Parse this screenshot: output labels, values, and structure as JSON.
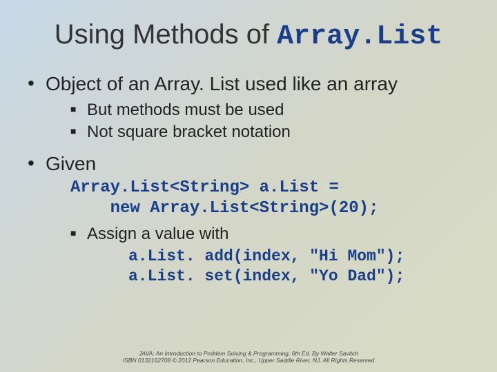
{
  "title": {
    "prefix": "Using Methods of ",
    "code": "Array.List"
  },
  "bullets": [
    {
      "text": "Object of an Array. List used like an array",
      "sub": [
        "But methods must be used",
        "Not square bracket notation"
      ]
    },
    {
      "text": "Given",
      "code": "Array.List<String> a.List =\n    new Array.List<String>(20);",
      "sub2": [
        {
          "text": "Assign a value with",
          "code": "a.List. add(index, \"Hi Mom\");\na.List. set(index, \"Yo Dad\");"
        }
      ]
    }
  ],
  "footer": {
    "line1": "JAVA: An Introduction to Problem Solving & Programming, 6th Ed. By Walter Savitch",
    "line2": "ISBN 0132162708 © 2012 Pearson Education, Inc., Upper Saddle River, NJ. All Rights Reserved"
  }
}
